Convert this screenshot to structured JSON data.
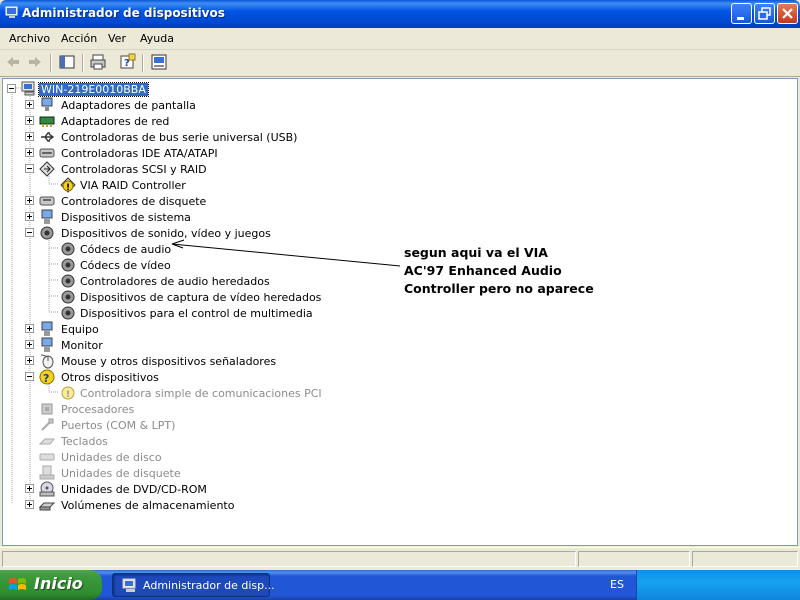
{
  "window": {
    "title": "Administrador de dispositivos"
  },
  "menu": [
    "Archivo",
    "Acción",
    "Ver",
    "Ayuda"
  ],
  "tree": {
    "root": "WIN-219E0010BBA",
    "items": [
      {
        "label": "Adaptadores de pantalla",
        "expanded": false,
        "icon": "display-adapter-icon"
      },
      {
        "label": "Adaptadores de red",
        "expanded": false,
        "icon": "network-adapter-icon"
      },
      {
        "label": "Controladoras de bus serie universal (USB)",
        "expanded": false,
        "icon": "usb-icon"
      },
      {
        "label": "Controladoras IDE ATA/ATAPI",
        "expanded": false,
        "icon": "ide-controller-icon"
      },
      {
        "label": "Controladoras SCSI y RAID",
        "expanded": true,
        "icon": "scsi-icon",
        "children": [
          {
            "label": "VIA RAID Controller",
            "icon": "warning-device-icon"
          }
        ]
      },
      {
        "label": "Controladores de disquete",
        "expanded": false,
        "icon": "floppy-controller-icon"
      },
      {
        "label": "Dispositivos de sistema",
        "expanded": false,
        "icon": "system-device-icon"
      },
      {
        "label": "Dispositivos de sonido, vídeo y juegos",
        "expanded": true,
        "icon": "sound-icon",
        "children": [
          {
            "label": "Códecs de audio",
            "icon": "sound-icon"
          },
          {
            "label": "Códecs de vídeo",
            "icon": "sound-icon"
          },
          {
            "label": "Controladores de audio heredados",
            "icon": "sound-icon"
          },
          {
            "label": "Dispositivos de captura de vídeo heredados",
            "icon": "sound-icon"
          },
          {
            "label": "Dispositivos para el control de multimedia",
            "icon": "sound-icon"
          }
        ]
      },
      {
        "label": "Equipo",
        "expanded": false,
        "icon": "computer-icon"
      },
      {
        "label": "Monitor",
        "expanded": false,
        "icon": "monitor-icon"
      },
      {
        "label": "Mouse y otros dispositivos señaladores",
        "expanded": false,
        "icon": "mouse-icon"
      },
      {
        "label": "Otros dispositivos",
        "expanded": true,
        "icon": "unknown-device-icon",
        "children": [
          {
            "label": "Controladora simple de comunicaciones PCI",
            "icon": "warning-device-icon",
            "disabled": true
          }
        ]
      },
      {
        "label": "Procesadores",
        "disabled": true,
        "icon": "processor-icon"
      },
      {
        "label": "Puertos (COM & LPT)",
        "disabled": true,
        "icon": "port-icon"
      },
      {
        "label": "Teclados",
        "disabled": true,
        "icon": "keyboard-icon"
      },
      {
        "label": "Unidades de disco",
        "disabled": true,
        "icon": "disk-drive-icon"
      },
      {
        "label": "Unidades de disquete",
        "disabled": true,
        "icon": "floppy-drive-icon"
      },
      {
        "label": "Unidades de DVD/CD-ROM",
        "expanded": false,
        "icon": "dvd-icon"
      },
      {
        "label": "Volúmenes de almacenamiento",
        "expanded": false,
        "icon": "storage-volume-icon"
      }
    ]
  },
  "annotation": {
    "lines": [
      "segun aqui va el VIA",
      "AC'97 Enhanced Audio",
      "Controller pero no aparece"
    ]
  },
  "taskbar": {
    "start": "Inicio",
    "task": "Administrador de disp...",
    "language": "ES"
  }
}
